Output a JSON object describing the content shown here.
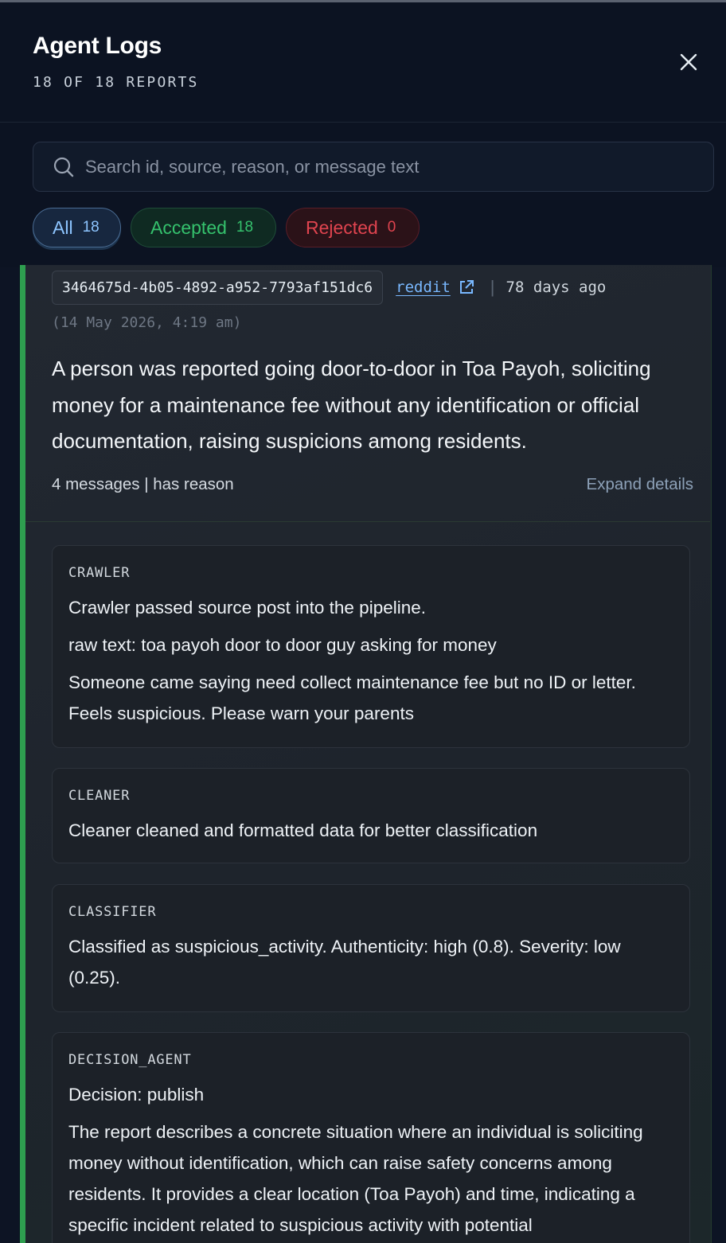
{
  "header": {
    "title": "Agent Logs",
    "subtitle": "18 OF 18 REPORTS",
    "close_icon": "close-icon"
  },
  "search": {
    "placeholder": "Search id, source, reason, or message text",
    "value": "",
    "icon": "search-icon"
  },
  "filters": [
    {
      "label": "All",
      "count": "18",
      "selected": true,
      "color": "#8ec5ff"
    },
    {
      "label": "Accepted",
      "count": "18",
      "selected": false,
      "color": "#35c26d"
    },
    {
      "label": "Rejected",
      "count": "0",
      "selected": false,
      "color": "#e0444f"
    }
  ],
  "report": {
    "id": "3464675d-4b05-4892-a952-7793af151dc6",
    "source": "reddit",
    "separator": "|",
    "age": "78 days ago",
    "datetime": "(14 May 2026, 4:19 am)",
    "summary": "A person was reported going door-to-door in Toa Payoh, soliciting money for a maintenance fee without any identification or official documentation, raising suspicions among residents.",
    "info": "4 messages | has reason",
    "expand_label": "Expand details",
    "status_color": "#2e9e4f",
    "messages": [
      {
        "role": "CRAWLER",
        "lines": [
          "Crawler passed source post into the pipeline.",
          "raw text: toa payoh door to door guy asking for money",
          "Someone came saying need collect maintenance fee but no ID or letter. Feels suspicious. Please warn your parents"
        ]
      },
      {
        "role": "CLEANER",
        "lines": [
          "Cleaner cleaned and formatted data for better classification"
        ]
      },
      {
        "role": "CLASSIFIER",
        "lines": [
          "Classified as suspicious_activity. Authenticity: high (0.8). Severity: low (0.25)."
        ]
      },
      {
        "role": "DECISION_AGENT",
        "lines": [
          "Decision: publish",
          "The report describes a concrete situation where an individual is soliciting money without identification, which can raise safety concerns among residents. It provides a clear location (Toa Payoh) and time, indicating a specific incident related to suspicious activity with potential"
        ]
      }
    ]
  }
}
